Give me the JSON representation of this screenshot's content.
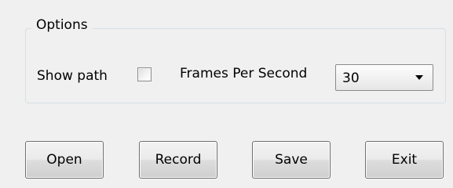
{
  "options_group": {
    "title": "Options",
    "show_path_label": "Show path",
    "show_path_checked": false,
    "fps_label": "Frames Per Second",
    "fps_value": "30"
  },
  "buttons": {
    "open": "Open",
    "record": "Record",
    "save": "Save",
    "exit": "Exit"
  },
  "icons": {
    "dropdown": "chevron-down-icon"
  },
  "colors": {
    "background": "#f0f0f0",
    "groupbox_border": "#d5dfe5",
    "button_border": "#707070"
  }
}
